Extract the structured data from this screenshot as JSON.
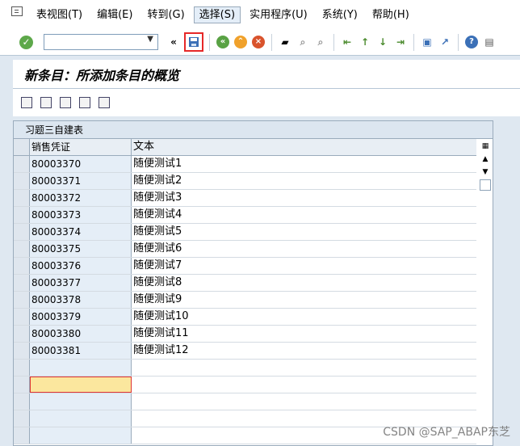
{
  "menu": {
    "items": [
      {
        "label": "表视图(T)",
        "active": false
      },
      {
        "label": "编辑(E)",
        "active": false
      },
      {
        "label": "转到(G)",
        "active": false
      },
      {
        "label": "选择(S)",
        "active": true
      },
      {
        "label": "实用程序(U)",
        "active": false
      },
      {
        "label": "系统(Y)",
        "active": false
      },
      {
        "label": "帮助(H)",
        "active": false
      }
    ]
  },
  "toolbar": {
    "command_value": "",
    "icons": [
      "enter-icon",
      "command-field",
      "save-icon",
      "back-icon",
      "exit-icon",
      "cancel-icon",
      "print-icon",
      "find-icon",
      "find-next-icon",
      "first-page-icon",
      "prev-page-icon",
      "next-page-icon",
      "last-page-icon",
      "new-session-icon",
      "shortcut-icon",
      "help-icon",
      "layout-icon"
    ]
  },
  "title": "新条目：所添加条目的概览",
  "alv": {
    "title": "习题三自建表",
    "columns": [
      "销售凭证",
      "文本"
    ],
    "rows": [
      [
        "80003370",
        "随便测试1"
      ],
      [
        "80003371",
        "随便测试2"
      ],
      [
        "80003372",
        "随便测试3"
      ],
      [
        "80003373",
        "随便测试4"
      ],
      [
        "80003374",
        "随便测试5"
      ],
      [
        "80003375",
        "随便测试6"
      ],
      [
        "80003376",
        "随便测试7"
      ],
      [
        "80003377",
        "随便测试8"
      ],
      [
        "80003378",
        "随便测试9"
      ],
      [
        "80003379",
        "随便测试10"
      ],
      [
        "80003380",
        "随便测试11"
      ],
      [
        "80003381",
        "随便测试12"
      ]
    ],
    "empty_rows": 5
  },
  "watermark": "CSDN @SAP_ABAP东芝"
}
